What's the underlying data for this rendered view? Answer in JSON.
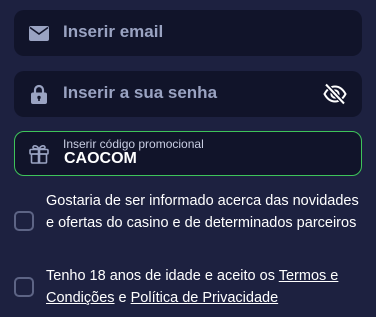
{
  "email": {
    "placeholder": "Inserir email",
    "value": "",
    "icon": "envelope-icon"
  },
  "password": {
    "placeholder": "Inserir a sua senha",
    "value": "",
    "icon": "lock-icon",
    "toggle_icon": "eye-slash-icon"
  },
  "promo": {
    "label": "Inserir código promocional",
    "value": "CAOCOM",
    "icon": "gift-icon",
    "border_color": "#3ec45a"
  },
  "consent": {
    "text": "Gostaria de ser informado acerca das novidades e ofertas do casino e de determinados parceiros",
    "checked": false
  },
  "terms": {
    "text_before": "Tenho 18 anos de idade e aceito os ",
    "terms_link": "Termos e Condições",
    "connector": " e ",
    "privacy_link": "Política de Privacidade",
    "checked": false
  },
  "colors": {
    "background": "#1d2140",
    "field_background": "#11142a",
    "placeholder": "#9aa3c2",
    "accent_green": "#3ec45a"
  }
}
